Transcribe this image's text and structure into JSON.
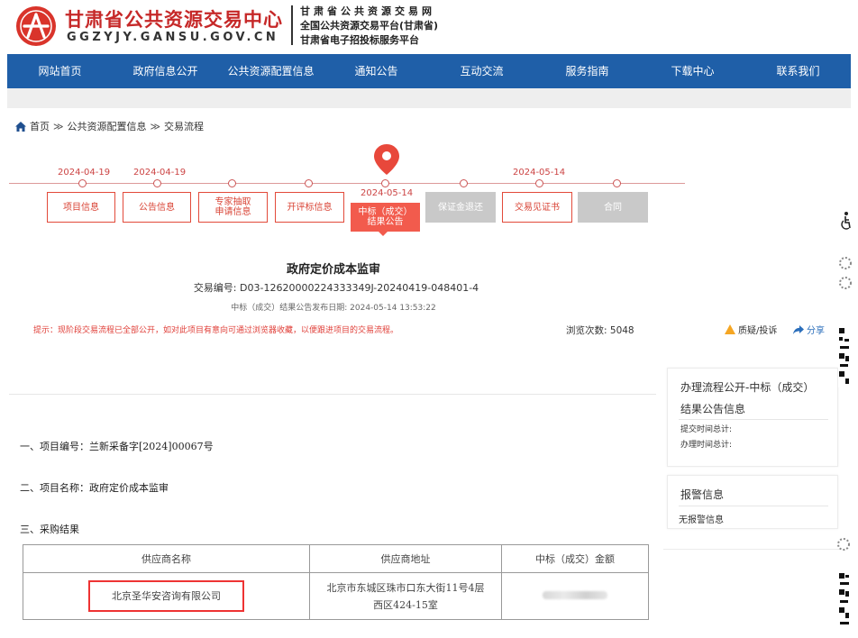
{
  "header": {
    "site_title": "甘肃省公共资源交易中心",
    "site_domain": "GGZYJY.GANSU.GOV.CN",
    "sub_lines": [
      "甘肃省公共资源交易网",
      "全国公共资源交易平台(甘肃省)",
      "甘肃省电子招投标服务平台"
    ]
  },
  "nav": {
    "items": [
      "网站首页",
      "政府信息公开",
      "公共资源配置信息",
      "通知公告",
      "互动交流",
      "服务指南",
      "下载中心",
      "联系我们"
    ]
  },
  "breadcrumb": {
    "home": "首页",
    "sep": "≫",
    "items": [
      "公共资源配置信息",
      "交易流程"
    ]
  },
  "timeline": {
    "dates": [
      "2024-04-19",
      "2024-04-19",
      "2024-05-14",
      "2024-05-14"
    ],
    "steps": [
      {
        "label": "项目信息",
        "state": "normal"
      },
      {
        "label": "公告信息",
        "state": "normal"
      },
      {
        "label": "专家抽取 申请信息",
        "state": "normal"
      },
      {
        "label": "开评标信息",
        "state": "normal"
      },
      {
        "label": "中标（成交） 结果公告",
        "state": "active"
      },
      {
        "label": "保证金退还",
        "state": "gray"
      },
      {
        "label": "交易见证书",
        "state": "normal"
      },
      {
        "label": "合同",
        "state": "gray"
      }
    ]
  },
  "project": {
    "title": "政府定价成本监审",
    "tx_no_label": "交易编号:",
    "tx_no": "D03-12620000224333349J-20240419-048401-4",
    "pub_label": "中标（成交）结果公告发布日期:",
    "pub_date": "2024-05-14 13:53:22",
    "tip": "提示：现阶段交易流程已全部公开，如对此项目有意向可通过浏览器收藏，以便跟进项目的交易流程。",
    "views_label": "浏览次数:",
    "views": "5048",
    "complain": "质疑/投诉",
    "share": "分享"
  },
  "content": {
    "line1": "一、项目编号：兰新采备字[2024]00067号",
    "line2": "二、项目名称：政府定价成本监审",
    "line3": "三、采购结果",
    "table": {
      "headers": [
        "供应商名称",
        "供应商地址",
        "中标（成交）金额"
      ],
      "supplier": "北京圣华安咨询有限公司",
      "address_line1": "北京市东城区珠市口东大街11号4层",
      "address_line2": "西区424-15室"
    }
  },
  "right_panel": {
    "title1": "办理流程公开-中标（成交）",
    "title2": "结果公告信息",
    "submit_label": "提交时间总计:",
    "handle_label": "办理时间总计:",
    "alarm_title": "报警信息",
    "alarm_value": "无报警信息"
  },
  "colors": {
    "brand_red": "#c62828",
    "nav_blue": "#1f5fa8",
    "step_red": "#e24a3a",
    "active_red": "#f25b4d"
  }
}
